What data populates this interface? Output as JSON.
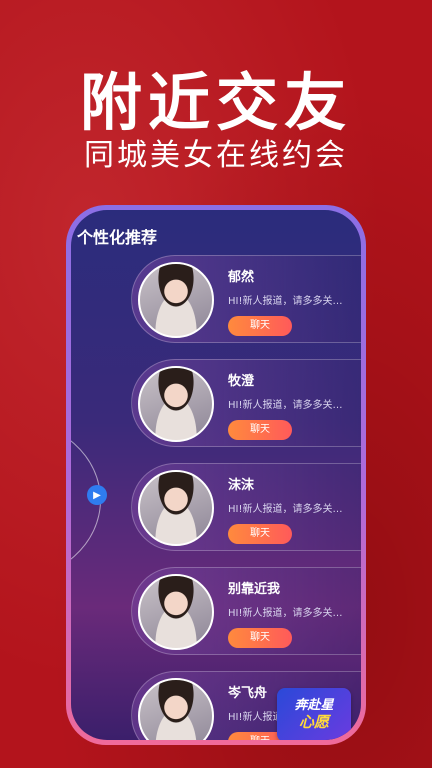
{
  "promo": {
    "headline": "附近交友",
    "subheadline": "同城美女在线约会"
  },
  "screen": {
    "title": "个性化推荐",
    "play_icon": "play-icon",
    "users": [
      {
        "name": "郁然",
        "greeting": "HI!新人报道，请多多关…",
        "chat_label": "聊天"
      },
      {
        "name": "牧澄",
        "greeting": "HI!新人报道，请多多关…",
        "chat_label": "聊天"
      },
      {
        "name": "沫沫",
        "greeting": "HI!新人报道，请多多关…",
        "chat_label": "聊天"
      },
      {
        "name": "别靠近我",
        "greeting": "HI!新人报道，请多多关…",
        "chat_label": "聊天"
      },
      {
        "name": "岑飞舟",
        "greeting": "HI!新人报道，请多多关…",
        "chat_label": "聊天"
      }
    ]
  },
  "badge": {
    "line1": "奔赴星",
    "line2": "心愿"
  },
  "colors": {
    "background": "#b3141c",
    "chat_button": "#ff6a4a",
    "frame": "#a46adf"
  }
}
